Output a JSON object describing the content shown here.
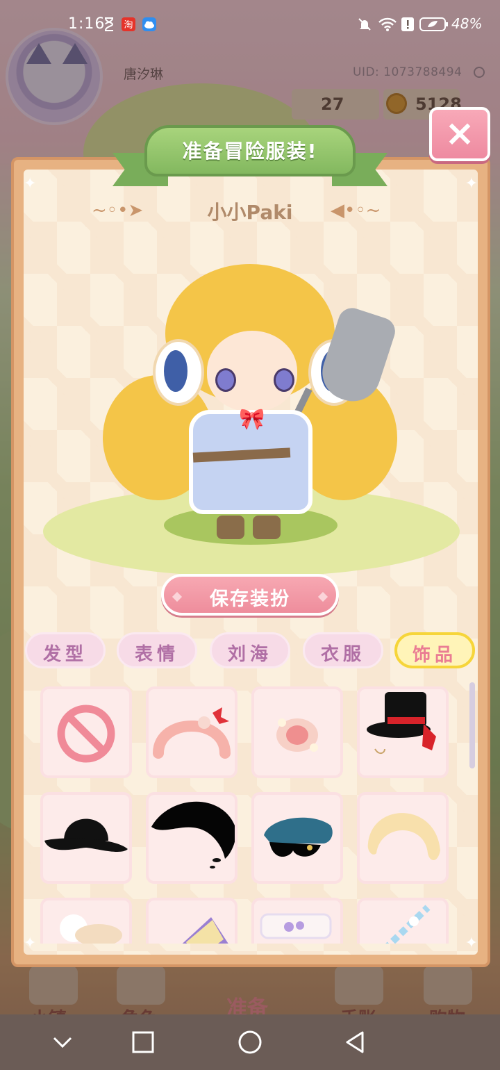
{
  "status_bar": {
    "time": "1:16",
    "battery": "48%",
    "icons": [
      "hourglass-icon",
      "taobao-icon",
      "cloud-icon",
      "mute-icon",
      "wifi-icon",
      "alert-icon",
      "battery-icon"
    ]
  },
  "hud": {
    "player_name": "唐汐琳",
    "uid": "UID: 1073788494",
    "stat_value": "27",
    "coins": "5128"
  },
  "dialog": {
    "title": "准备冒险服装!",
    "character_name": "小小Paki",
    "close_label": "×",
    "save_button": "保存装扮"
  },
  "tabs": [
    {
      "label": "发型",
      "active": false
    },
    {
      "label": "表情",
      "active": false
    },
    {
      "label": "刘海",
      "active": false
    },
    {
      "label": "衣服",
      "active": false
    },
    {
      "label": "饰品",
      "active": true
    }
  ],
  "items": [
    "none-icon",
    "pink-headband-icon",
    "pearl-hairpin-icon",
    "black-top-hat-icon",
    "black-bowler-hat-icon",
    "black-bangs-icon",
    "blue-sailor-cap-icon",
    "cream-headband-icon",
    "white-cloud-hairpiece-icon",
    "purple-book-icon",
    "lavender-ribbon-icon",
    "blue-straw-icon"
  ],
  "game_nav": [
    {
      "label": "小镇",
      "active": false
    },
    {
      "label": "角色",
      "active": false
    },
    {
      "label": "准备",
      "active": true
    },
    {
      "label": "手账",
      "active": false
    },
    {
      "label": "购物",
      "active": false
    }
  ],
  "colors": {
    "accent_pink": "#ee8d9c",
    "ribbon_green": "#83b85f",
    "active_tab_yellow": "#f6d53a",
    "panel_frame": "#e7b282"
  }
}
